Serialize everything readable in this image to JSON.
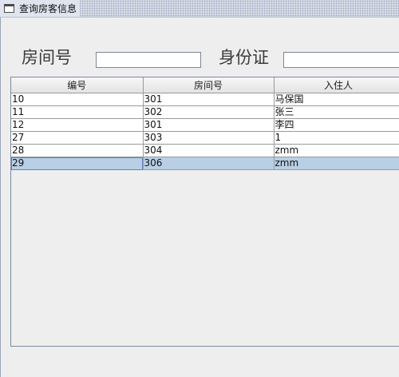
{
  "window": {
    "title": "查询房客信息"
  },
  "search": {
    "room_label": "房间号",
    "room_value": "",
    "id_label": "身份证",
    "id_value": ""
  },
  "table": {
    "columns": [
      "编号",
      "房间号",
      "入住人"
    ],
    "rows": [
      [
        "10",
        "301",
        "马保国"
      ],
      [
        "11",
        "302",
        "张三"
      ],
      [
        "12",
        "301",
        "李四"
      ],
      [
        "27",
        "303",
        "1"
      ],
      [
        "28",
        "304",
        "zmm"
      ],
      [
        "29",
        "306",
        "zmm"
      ]
    ],
    "selected_row": 5
  }
}
